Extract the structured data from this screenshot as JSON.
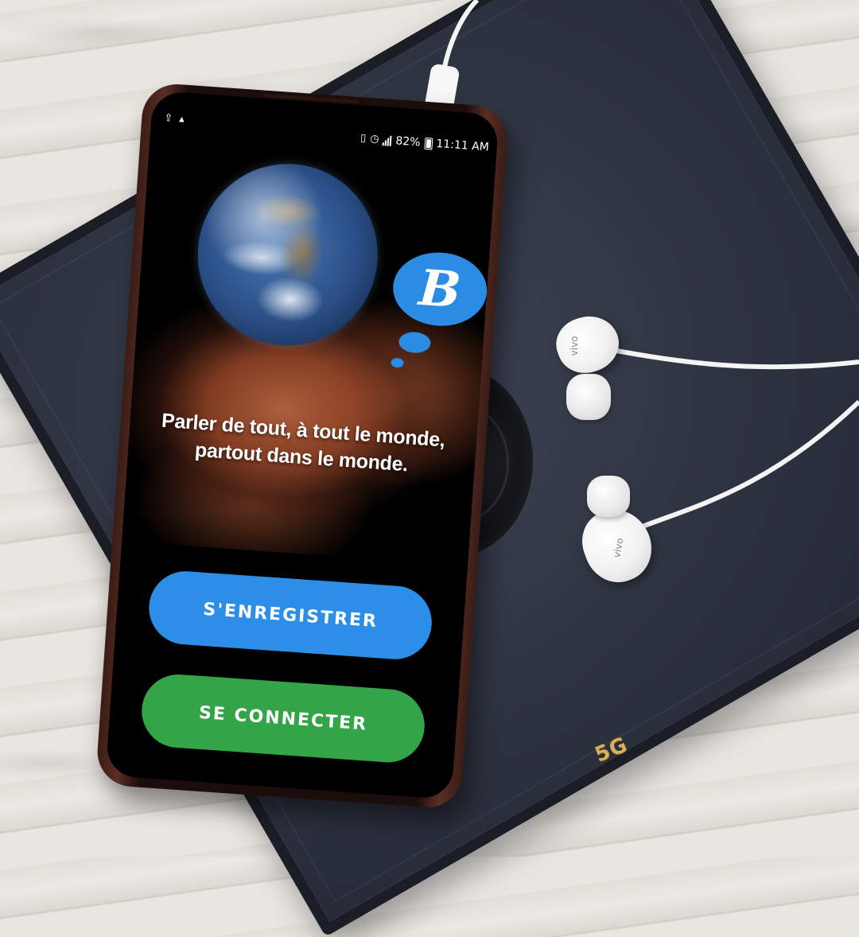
{
  "status_bar": {
    "battery": "82%",
    "time": "11:11 AM"
  },
  "app": {
    "logo_letter": "B",
    "tagline_line1": "Parler de tout, à tout le monde,",
    "tagline_line2": "partout dans le monde.",
    "register_label": "S'ENREGISTRER",
    "login_label": "SE CONNECTER"
  },
  "colors": {
    "register_button": "#2d8ee8",
    "login_button": "#34a449",
    "logo_bubble": "#2c8be3"
  },
  "scene": {
    "earphone_brand": "vivo",
    "box_badge": "5G"
  }
}
